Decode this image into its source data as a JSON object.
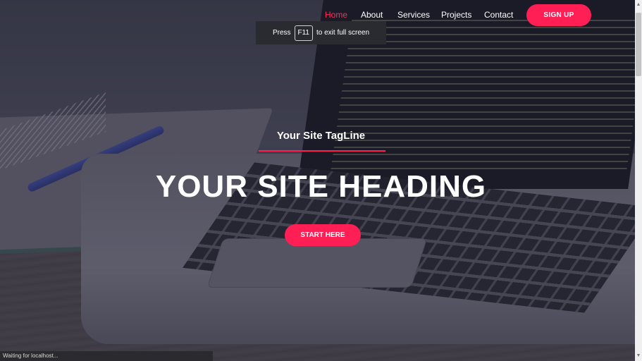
{
  "nav": {
    "items": [
      {
        "label": "Home",
        "active": true
      },
      {
        "label": "About",
        "active": false
      },
      {
        "label": "Services",
        "active": false
      },
      {
        "label": "Projects",
        "active": false
      },
      {
        "label": "Contact",
        "active": false
      }
    ],
    "signup_label": "SIGN UP"
  },
  "fullscreen_notice": {
    "prefix": "Press",
    "key": "F11",
    "suffix": "to exit full screen"
  },
  "hero": {
    "tagline": "Your Site TagLine",
    "heading": "YOUR SITE HEADING",
    "cta_label": "START HERE"
  },
  "status_bar": {
    "text": "Waiting for localhost..."
  },
  "colors": {
    "accent": "#ff1f54",
    "nav_active": "#ff2d5a"
  },
  "icons": {
    "scroll_up": "scroll-up-arrow-icon",
    "scroll_down": "scroll-down-arrow-icon"
  }
}
